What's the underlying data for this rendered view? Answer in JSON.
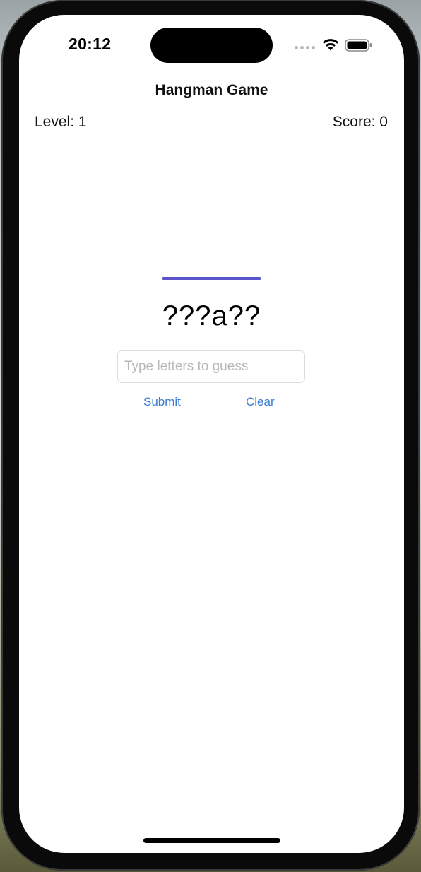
{
  "status_bar": {
    "time": "20:12",
    "icons": [
      "cellular-signal-icon",
      "wifi-icon",
      "battery-icon"
    ]
  },
  "nav": {
    "title": "Hangman Game"
  },
  "game": {
    "level_label": "Level: 1",
    "score_label": "Score: 0",
    "masked_word": "???a??",
    "accent_color": "#5b54cb"
  },
  "guess": {
    "value": "",
    "placeholder": "Type letters to guess"
  },
  "actions": {
    "submit_label": "Submit",
    "clear_label": "Clear",
    "link_color": "#3a7bd5"
  }
}
